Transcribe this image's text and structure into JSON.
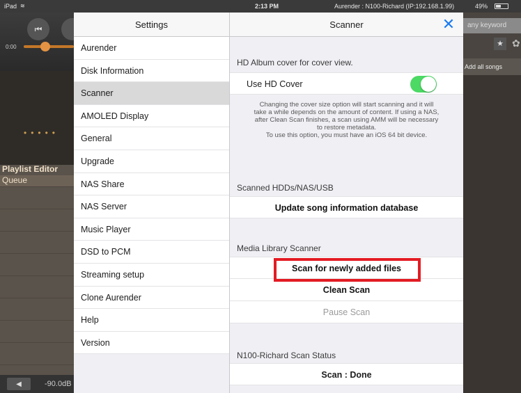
{
  "statusbar": {
    "device": "iPad",
    "wifi_icon": "wifi-icon",
    "time": "2:13 PM",
    "server": "Aurender : N100-Richard (IP:192.168.1.99)",
    "battery_text": "49%"
  },
  "background_app": {
    "time": "0:00",
    "playlist_editor": "Playlist Editor",
    "queue": "Queue",
    "volume": "-90.0dB",
    "search_placeholder": "any keyword",
    "add_all": "Add all songs"
  },
  "settings": {
    "title": "Settings",
    "items": [
      {
        "label": "Aurender"
      },
      {
        "label": "Disk Information"
      },
      {
        "label": "Scanner",
        "selected": true
      },
      {
        "label": "AMOLED Display"
      },
      {
        "label": "General"
      },
      {
        "label": "Upgrade"
      },
      {
        "label": "NAS Share"
      },
      {
        "label": "NAS Server"
      },
      {
        "label": "Music Player"
      },
      {
        "label": "DSD to PCM"
      },
      {
        "label": "Streaming setup"
      },
      {
        "label": "Clone Aurender"
      },
      {
        "label": "Help"
      },
      {
        "label": "Version"
      }
    ]
  },
  "scanner": {
    "title": "Scanner",
    "close_icon": "close-icon",
    "hd_section_header": "HD Album cover for cover view.",
    "hd_toggle_label": "Use HD Cover",
    "hd_toggle_on": true,
    "hd_description_lines": [
      "Changing the cover size option will start scanning and it will",
      "take a while depends on the amount of content. If using a NAS,",
      "after Clean Scan finishes, a scan using AMM will be necessary",
      "to restore metadata.",
      "To use this option, you must have an iOS 64 bit device."
    ],
    "hdd_section_header": "Scanned HDDs/NAS/USB",
    "update_db_label": "Update song information database",
    "media_section_header": "Media Library Scanner",
    "scan_new_label": "Scan for newly added files",
    "clean_scan_label": "Clean Scan",
    "pause_scan_label": "Pause Scan",
    "status_section_header": "N100-Richard Scan Status",
    "status_label": "Scan : Done"
  },
  "colors": {
    "accent": "#1a7bf2",
    "toggle_on": "#4cd964",
    "highlight": "#e31b23"
  }
}
